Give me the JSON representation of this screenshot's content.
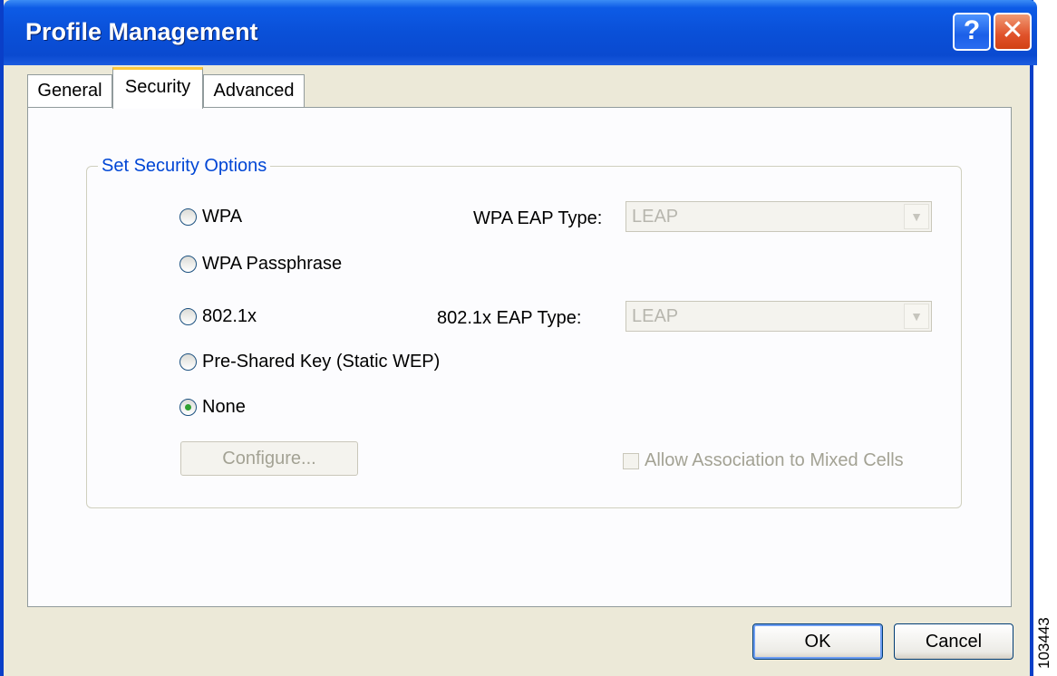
{
  "window": {
    "title": "Profile Management"
  },
  "title_buttons": {
    "help": "?",
    "close": "✕"
  },
  "tabs": [
    {
      "label": "General",
      "active": false
    },
    {
      "label": "Security",
      "active": true
    },
    {
      "label": "Advanced",
      "active": false
    }
  ],
  "security": {
    "group_title": "Set Security Options",
    "options": [
      {
        "label": "WPA",
        "checked": false
      },
      {
        "label": "WPA Passphrase",
        "checked": false
      },
      {
        "label": "802.1x",
        "checked": false
      },
      {
        "label": "Pre-Shared Key (Static WEP)",
        "checked": false
      },
      {
        "label": "None",
        "checked": true
      }
    ],
    "wpa_eap": {
      "label": "WPA EAP Type:",
      "value": "LEAP"
    },
    "dot1x_eap": {
      "label": "802.1x EAP Type:",
      "value": "LEAP"
    },
    "configure_button": "Configure...",
    "mixed_cells": {
      "label": "Allow Association to Mixed Cells",
      "checked": false
    }
  },
  "footer": {
    "ok": "OK",
    "cancel": "Cancel"
  },
  "side_id": "103443",
  "colors": {
    "titlebar": "#0a50d8",
    "accent_tab": "#ffc83c",
    "group_title": "#0046d5",
    "disabled_text": "#a3a294"
  }
}
